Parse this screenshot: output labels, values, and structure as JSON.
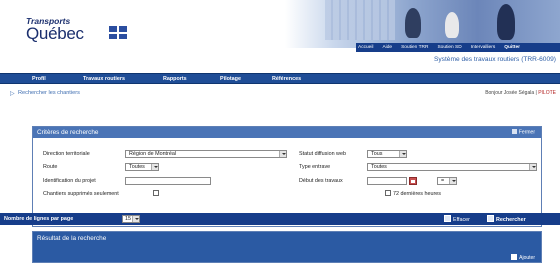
{
  "header": {
    "logo_top": "Transports",
    "logo_main": "Québec",
    "top_links": [
      "Accueil",
      "Aide",
      "Soutien TRR",
      "Soutien SD",
      "Intervalliers",
      "Quitter"
    ],
    "system_title": "Système des travaux routiers (TRR-6009)"
  },
  "nav": {
    "items": [
      "Profil",
      "Travaux routiers",
      "Rapports",
      "Pilotage",
      "Références"
    ]
  },
  "breadcrumb": "Rechercher les chantiers",
  "user": {
    "greeting": "Bonjour Josée Ségala",
    "role": "PILOTE"
  },
  "criteria": {
    "title": "Critères de recherche",
    "close_label": "Fermer",
    "fields": {
      "direction_label": "Direction territoriale",
      "direction_value": "Région de Montréal",
      "statut_label": "Statut diffusion web",
      "statut_value": "Tous",
      "route_label": "Route",
      "route_value": "Toutes",
      "type_entrave_label": "Type entrave",
      "type_entrave_value": "Toutes",
      "identification_label": "Identification du projet",
      "identification_value": "",
      "debut_label": "Début des travaux",
      "debut_value": "",
      "debut_op": "=",
      "chantiers_label": "Chantiers supprimés seulement",
      "last72_label": "72 dernières heures"
    }
  },
  "bottom_bar": {
    "lines_label": "Nombre de lignes par page",
    "lines_value": "15",
    "clear_label": "Effacer",
    "search_label": "Rechercher"
  },
  "results": {
    "title": "Résultat de la recherche",
    "add_label": "Ajouter"
  }
}
